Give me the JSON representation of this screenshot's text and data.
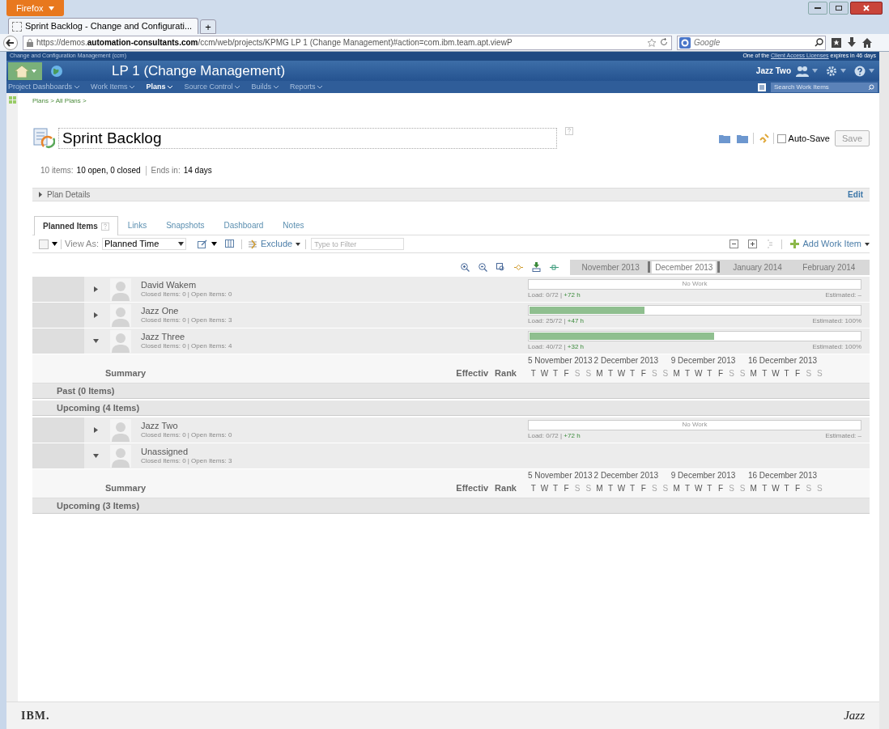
{
  "browser": {
    "menu_button": "Firefox",
    "tabs": [
      {
        "title": "Sprint Backlog - Change and Configurati...",
        "selected": true
      }
    ],
    "new_tab": "+",
    "url": "https://demos.**automation-consultants.com**/ccm/web/projects/KPMG LP 1 (Change Management)#action=com.ibm.team.apt.viewP",
    "search_engine": "Google"
  },
  "app": {
    "product": "Change and Configuration Management (ccm)",
    "license_prefix": "One of the ",
    "license_link": "Client Access Licenses",
    "license_suffix": " expires in 46 days",
    "project": "LP 1 (Change Management)",
    "user": "Jazz Two",
    "nav": [
      {
        "label": "Project Dashboards",
        "selected": false
      },
      {
        "label": "Work Items",
        "selected": false
      },
      {
        "label": "Plans",
        "selected": true
      },
      {
        "label": "Source Control",
        "selected": false
      },
      {
        "label": "Builds",
        "selected": false
      },
      {
        "label": "Reports",
        "selected": false
      }
    ],
    "search_placeholder": "Search Work Items"
  },
  "breadcrumb": "Plans > All Plans >",
  "plan": {
    "title": "Sprint Backlog",
    "items_label": "10 items:",
    "items_value": "10 open, 0 closed",
    "ends_label": "Ends in:",
    "ends_value": "14 days",
    "auto_save": {
      "label": "Auto-Save",
      "checked": false
    },
    "save": "Save",
    "details": "Plan Details",
    "details_expanded": false,
    "edit": "Edit"
  },
  "tabs": [
    {
      "label": "Planned Items",
      "selected": true
    },
    {
      "label": "Links",
      "selected": false
    },
    {
      "label": "Snapshots",
      "selected": false
    },
    {
      "label": "Dashboard",
      "selected": false
    },
    {
      "label": "Notes",
      "selected": false
    }
  ],
  "toolbar": {
    "select_all": {
      "checked": false
    },
    "view_as": "View As:",
    "view": "Planned Time",
    "exclude": "Exclude",
    "filter_placeholder": "Type to Filter",
    "add": "Add Work Item"
  },
  "months": [
    "November 2013",
    "December 2013",
    "January 2014",
    "February 2014"
  ],
  "rows": [
    {
      "kind": "owner",
      "name": "David Wakem",
      "stats": "Closed Items: 0 | Open Items: 0",
      "expanded": false,
      "bar_text": "No Work",
      "level": 0,
      "load": "Load: 0/72 | ",
      "remaining": "+72 h",
      "estimated": "Estimated: –"
    },
    {
      "kind": "owner",
      "name": "Jazz One",
      "stats": "Closed Items: 0 | Open Items: 3",
      "expanded": false,
      "level": 0.35,
      "load": "Load: 25/72 | ",
      "remaining": "+47 h",
      "estimated": "Estimated: 100%"
    },
    {
      "kind": "owner",
      "name": "Jazz Three",
      "stats": "Closed Items: 0 | Open Items: 4",
      "expanded": true,
      "level": 0.56,
      "load": "Load: 40/72 | ",
      "remaining": "+32 h",
      "estimated": "Estimated: 100%"
    },
    {
      "kind": "summary",
      "summary": "Summary",
      "effective": "Effectiv",
      "rank": "Rank",
      "weeks": [
        {
          "label": "5 November 2013",
          "days": [
            {
              "d": "T",
              "weekend": false
            },
            {
              "d": "W",
              "weekend": false
            },
            {
              "d": "T",
              "weekend": false
            },
            {
              "d": "F",
              "weekend": false
            },
            {
              "d": "S",
              "weekend": true
            },
            {
              "d": "S",
              "weekend": true
            }
          ]
        },
        {
          "label": "2 December 2013",
          "days": [
            {
              "d": "M",
              "weekend": false
            },
            {
              "d": "T",
              "weekend": false
            },
            {
              "d": "W",
              "weekend": false
            },
            {
              "d": "T",
              "weekend": false
            },
            {
              "d": "F",
              "weekend": false
            },
            {
              "d": "S",
              "weekend": true
            },
            {
              "d": "S",
              "weekend": true
            }
          ]
        },
        {
          "label": "9 December 2013",
          "days": [
            {
              "d": "M",
              "weekend": false
            },
            {
              "d": "T",
              "weekend": false
            },
            {
              "d": "W",
              "weekend": false
            },
            {
              "d": "T",
              "weekend": false
            },
            {
              "d": "F",
              "weekend": false
            },
            {
              "d": "S",
              "weekend": true
            },
            {
              "d": "S",
              "weekend": true
            }
          ]
        },
        {
          "label": "16 December 2013",
          "days": [
            {
              "d": "M",
              "weekend": false
            },
            {
              "d": "T",
              "weekend": false
            },
            {
              "d": "W",
              "weekend": false
            },
            {
              "d": "T",
              "weekend": false
            },
            {
              "d": "F",
              "weekend": false
            },
            {
              "d": "S",
              "weekend": true
            },
            {
              "d": "S",
              "weekend": true
            }
          ]
        }
      ]
    },
    {
      "kind": "group",
      "label": "Past  (0 Items)"
    },
    {
      "kind": "group",
      "label": "Upcoming  (4 Items)"
    },
    {
      "kind": "owner",
      "name": "Jazz Two",
      "stats": "Closed Items: 0 | Open Items: 0",
      "expanded": false,
      "bar_text": "No Work",
      "level": 0,
      "load": "Load: 0/72 | ",
      "remaining": "+72 h",
      "estimated": "Estimated: –"
    },
    {
      "kind": "owner",
      "name": "Unassigned",
      "stats": "Closed Items: 0 | Open Items: 3",
      "expanded": true
    },
    {
      "kind": "summary",
      "summary": "Summary",
      "effective": "Effectiv",
      "rank": "Rank",
      "weeks": [
        {
          "label": "5 November 2013",
          "days": [
            {
              "d": "T",
              "weekend": false
            },
            {
              "d": "W",
              "weekend": false
            },
            {
              "d": "T",
              "weekend": false
            },
            {
              "d": "F",
              "weekend": false
            },
            {
              "d": "S",
              "weekend": true
            },
            {
              "d": "S",
              "weekend": true
            }
          ]
        },
        {
          "label": "2 December 2013",
          "days": [
            {
              "d": "M",
              "weekend": false
            },
            {
              "d": "T",
              "weekend": false
            },
            {
              "d": "W",
              "weekend": false
            },
            {
              "d": "T",
              "weekend": false
            },
            {
              "d": "F",
              "weekend": false
            },
            {
              "d": "S",
              "weekend": true
            },
            {
              "d": "S",
              "weekend": true
            }
          ]
        },
        {
          "label": "9 December 2013",
          "days": [
            {
              "d": "M",
              "weekend": false
            },
            {
              "d": "T",
              "weekend": false
            },
            {
              "d": "W",
              "weekend": false
            },
            {
              "d": "T",
              "weekend": false
            },
            {
              "d": "F",
              "weekend": false
            },
            {
              "d": "S",
              "weekend": true
            },
            {
              "d": "S",
              "weekend": true
            }
          ]
        },
        {
          "label": "16 December 2013",
          "days": [
            {
              "d": "M",
              "weekend": false
            },
            {
              "d": "T",
              "weekend": false
            },
            {
              "d": "W",
              "weekend": false
            },
            {
              "d": "T",
              "weekend": false
            },
            {
              "d": "F",
              "weekend": false
            },
            {
              "d": "S",
              "weekend": true
            },
            {
              "d": "S",
              "weekend": true
            }
          ]
        }
      ]
    },
    {
      "kind": "group",
      "label": "Upcoming  (3 Items)"
    }
  ],
  "footer": {
    "left_logo": "IBM.",
    "right_logo": "Jazz"
  }
}
